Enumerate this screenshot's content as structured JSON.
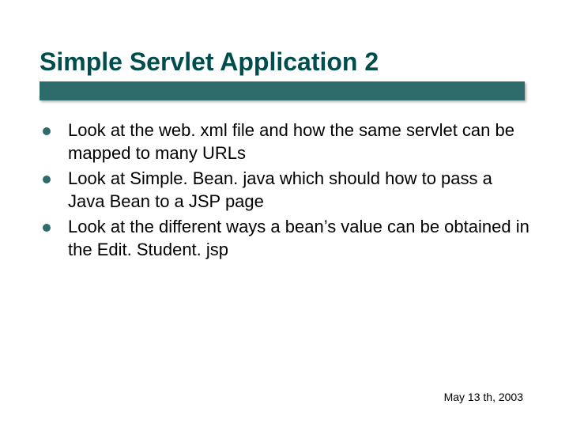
{
  "title": "Simple Servlet Application 2",
  "bullets": [
    "Look at the web. xml file and how the same servlet can be mapped to many URLs",
    "Look at Simple. Bean. java which should how to pass a Java Bean to a JSP page",
    "Look at the different ways a bean’s value can be obtained in the Edit. Student. jsp"
  ],
  "footer_date": "May 13 th, 2003"
}
